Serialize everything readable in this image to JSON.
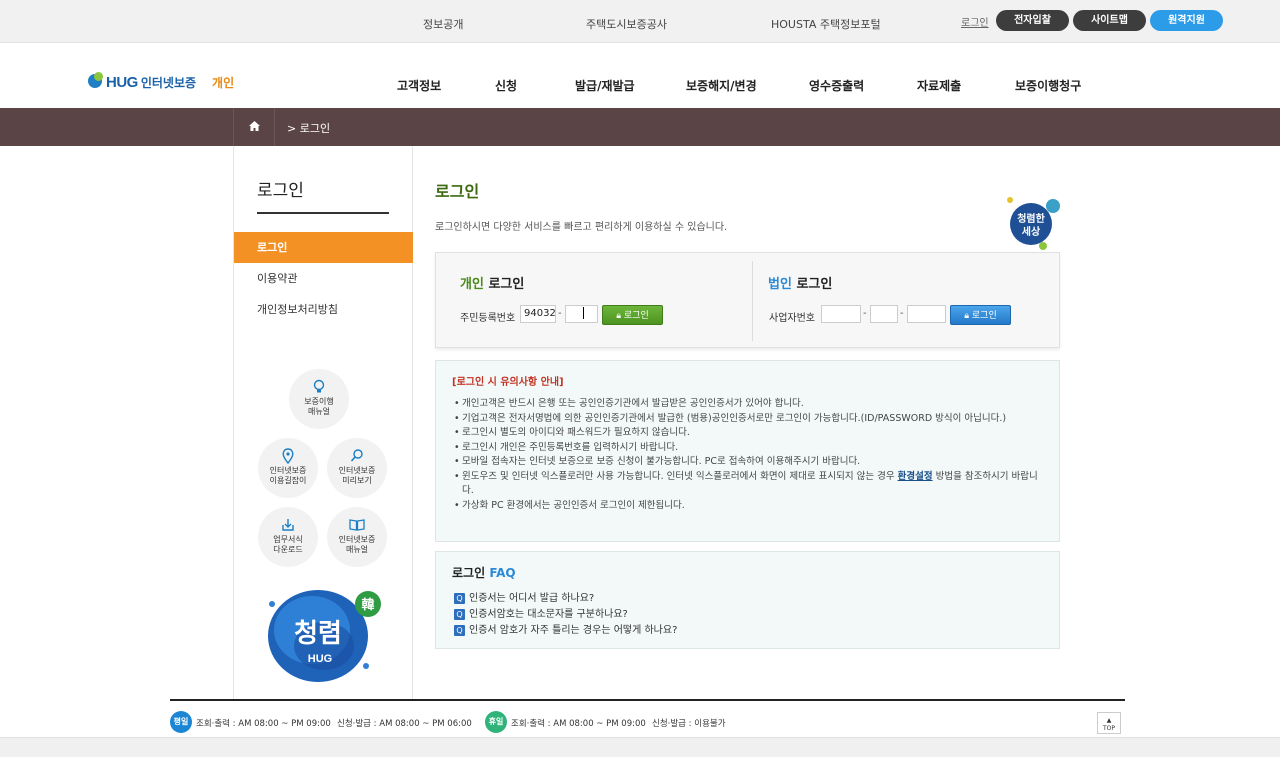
{
  "topbar": {
    "links": [
      "정보공개",
      "주택도시보증공사",
      "HOUSTA 주택정보포털"
    ],
    "login": "로그인",
    "buttons": [
      "전자입찰",
      "사이트맵",
      "원격지원"
    ],
    "colors": {
      "dark_pill": "#3d3d3d",
      "blue_pill": "#2c9be8"
    }
  },
  "header": {
    "brand": "HUG",
    "brand_sub": "인터넷보증",
    "section": "개인",
    "nav": [
      "고객정보",
      "신청",
      "발급/재발급",
      "보증해지/변경",
      "영수증출력",
      "자료제출",
      "보증이행청구"
    ]
  },
  "breadcrumb": {
    "home_icon": "home-icon",
    "current": "> 로그인"
  },
  "sidebar": {
    "title": "로그인",
    "items": [
      "로그인",
      "이용약관",
      "개인정보처리방침"
    ],
    "active_color": "#f39125",
    "quick": [
      {
        "label1": "보증이행",
        "label2": "매뉴얼",
        "icon": "lightbulb-icon"
      },
      {
        "label1": "인터넷보증",
        "label2": "이용길잡이",
        "icon": "location-pin-icon"
      },
      {
        "label1": "인터넷보증",
        "label2": "미리보기",
        "icon": "magnifier-icon"
      },
      {
        "label1": "업무서식",
        "label2": "다운로드",
        "icon": "download-icon"
      },
      {
        "label1": "인터넷보증",
        "label2": "매뉴얼",
        "icon": "book-icon"
      }
    ],
    "badge": {
      "main": "청렴",
      "sub": "HUG",
      "stamp": "韓"
    }
  },
  "main": {
    "title": "로그인",
    "description": "로그인하시면 다양한 서비스를 빠르고 편리하게 이용하실 수 있습니다.",
    "seal": {
      "line1": "청렴한",
      "line2": "세상"
    },
    "personal": {
      "title_a": "개인",
      "title_b": "로그인",
      "label": "주민등록번호",
      "value1": "94032",
      "value2": "",
      "button": "로그인"
    },
    "corporate": {
      "title_a": "법인",
      "title_b": "로그인",
      "label": "사업자번호",
      "button": "로그인"
    },
    "notice": {
      "title": "[로그인 시 유의사항 안내]",
      "items": [
        "개인고객은 반드시 은행 또는 공인인증기관에서 발급받은 공인인증서가 있어야 합니다.",
        "기업고객은 전자서명법에 의한 공인인증기관에서 발급한 (범용)공인인증서로만 로그인이 가능합니다.(ID/PASSWORD 방식이 아닙니다.)",
        "로그인시 별도의 아이디와 패스워드가 필요하지 않습니다.",
        "로그인시 개인은 주민등록번호를 입력하시기 바랍니다.",
        "모바일 접속자는 인터넷 보증으로 보증 신청이 불가능합니다. PC로 접속하여 이용해주시기 바랍니다."
      ],
      "item_browser_pre": "윈도우즈 및 인터넷 익스플로러만 사용 가능합니다. 인터넷 익스플로러에서 화면이 제대로 표시되지 않는 경우",
      "item_browser_link": "환경설정",
      "item_browser_post": "방법을 참조하시기 바랍니다.",
      "item_last": "가상화 PC 환경에서는 공인인증서 로그인이 제한됩니다."
    },
    "faq": {
      "title_a": "로그인",
      "title_b": "FAQ",
      "q_badge": "Q",
      "items": [
        "인증서는 어디서 발급 하나요?",
        "인증서암호는 대소문자를 구분하나요?",
        "인증서 암호가 자주 틀리는 경우는 어떻게 하나요?"
      ]
    }
  },
  "footer": {
    "weekday_badge": "평일",
    "weekday_view": "조회·출력 : AM 08:00 ~ PM 09:00",
    "weekday_apply": "신청·발급 : AM 08:00 ~ PM 06:00",
    "holiday_badge": "휴일",
    "holiday_view": "조회·출력 : AM 08:00 ~ PM 09:00",
    "holiday_apply": "신청·발급 : 이용불가",
    "top_button": "TOP",
    "colors": {
      "weekday": "#1d86d4",
      "holiday": "#2fb37a"
    }
  }
}
